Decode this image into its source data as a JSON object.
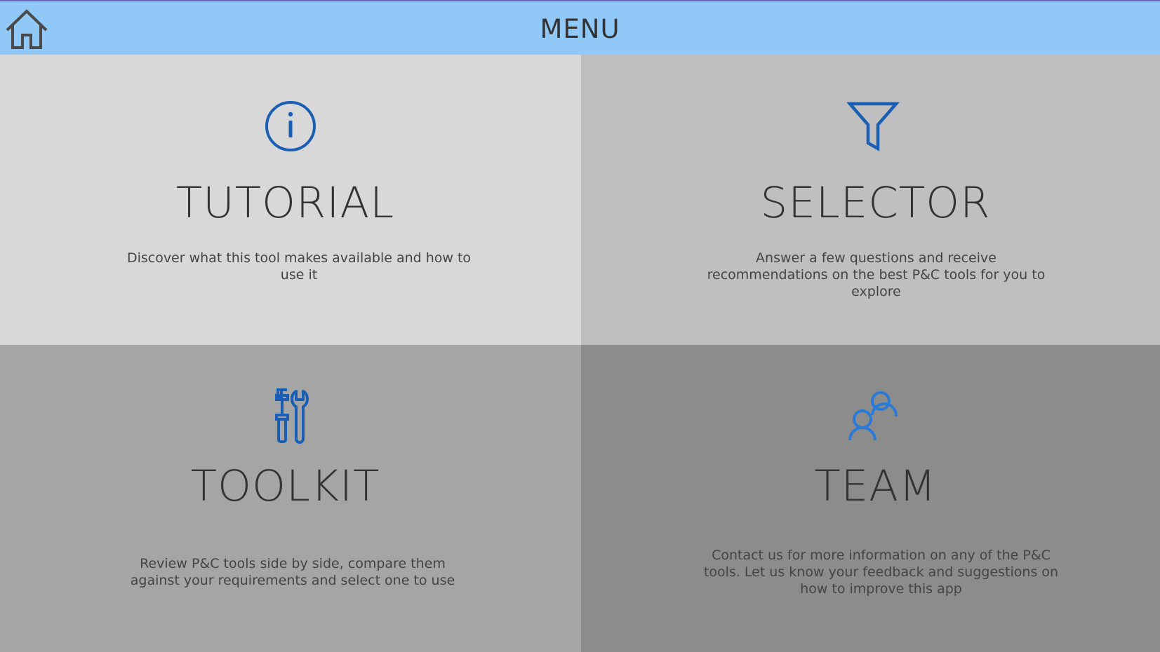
{
  "header": {
    "title": "MENU",
    "home_icon": "home-icon",
    "background": "#90c8f8"
  },
  "tiles": [
    {
      "id": "tutorial",
      "title": "TUTORIAL",
      "description": "Discover  what this tool makes available and how to use it",
      "icon": "info-circle-icon",
      "background": "#d8d8d8",
      "icon_color": "#1a5fb4"
    },
    {
      "id": "selector",
      "title": "SELECTOR",
      "description": "Answer a few questions and receive recommendations on the best P&C tools for you to explore",
      "icon": "filter-icon",
      "background": "#bfbfbf",
      "icon_color": "#1a5fb4"
    },
    {
      "id": "toolkit",
      "title": "TOOLKIT",
      "description": "Review P&C tools side by side, compare them against your requirements and select one to use",
      "icon": "tools-icon",
      "background": "#a5a5a5",
      "icon_color": "#1a5fb4"
    },
    {
      "id": "team",
      "title": "TEAM",
      "description": "Contact us for more information on any of the P&C tools. Let us know your feedback and suggestions on how to improve this app",
      "icon": "people-icon",
      "background": "#8c8c8c",
      "icon_color": "#2a7ad8"
    }
  ]
}
